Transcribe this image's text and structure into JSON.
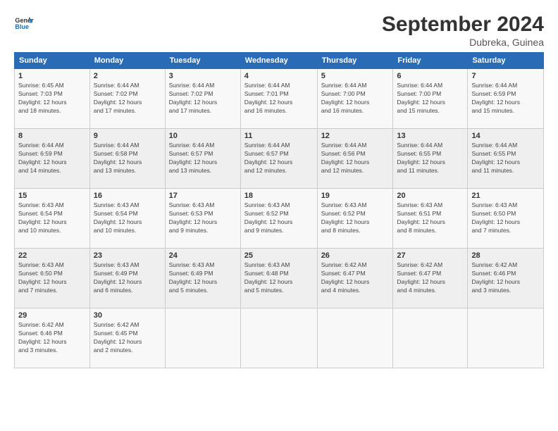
{
  "header": {
    "title": "September 2024",
    "subtitle": "Dubreka, Guinea"
  },
  "columns": [
    "Sunday",
    "Monday",
    "Tuesday",
    "Wednesday",
    "Thursday",
    "Friday",
    "Saturday"
  ],
  "weeks": [
    [
      {
        "day": "1",
        "detail": "Sunrise: 6:45 AM\nSunset: 7:03 PM\nDaylight: 12 hours\nand 18 minutes."
      },
      {
        "day": "2",
        "detail": "Sunrise: 6:44 AM\nSunset: 7:02 PM\nDaylight: 12 hours\nand 17 minutes."
      },
      {
        "day": "3",
        "detail": "Sunrise: 6:44 AM\nSunset: 7:02 PM\nDaylight: 12 hours\nand 17 minutes."
      },
      {
        "day": "4",
        "detail": "Sunrise: 6:44 AM\nSunset: 7:01 PM\nDaylight: 12 hours\nand 16 minutes."
      },
      {
        "day": "5",
        "detail": "Sunrise: 6:44 AM\nSunset: 7:00 PM\nDaylight: 12 hours\nand 16 minutes."
      },
      {
        "day": "6",
        "detail": "Sunrise: 6:44 AM\nSunset: 7:00 PM\nDaylight: 12 hours\nand 15 minutes."
      },
      {
        "day": "7",
        "detail": "Sunrise: 6:44 AM\nSunset: 6:59 PM\nDaylight: 12 hours\nand 15 minutes."
      }
    ],
    [
      {
        "day": "8",
        "detail": "Sunrise: 6:44 AM\nSunset: 6:59 PM\nDaylight: 12 hours\nand 14 minutes."
      },
      {
        "day": "9",
        "detail": "Sunrise: 6:44 AM\nSunset: 6:58 PM\nDaylight: 12 hours\nand 13 minutes."
      },
      {
        "day": "10",
        "detail": "Sunrise: 6:44 AM\nSunset: 6:57 PM\nDaylight: 12 hours\nand 13 minutes."
      },
      {
        "day": "11",
        "detail": "Sunrise: 6:44 AM\nSunset: 6:57 PM\nDaylight: 12 hours\nand 12 minutes."
      },
      {
        "day": "12",
        "detail": "Sunrise: 6:44 AM\nSunset: 6:56 PM\nDaylight: 12 hours\nand 12 minutes."
      },
      {
        "day": "13",
        "detail": "Sunrise: 6:44 AM\nSunset: 6:55 PM\nDaylight: 12 hours\nand 11 minutes."
      },
      {
        "day": "14",
        "detail": "Sunrise: 6:44 AM\nSunset: 6:55 PM\nDaylight: 12 hours\nand 11 minutes."
      }
    ],
    [
      {
        "day": "15",
        "detail": "Sunrise: 6:43 AM\nSunset: 6:54 PM\nDaylight: 12 hours\nand 10 minutes."
      },
      {
        "day": "16",
        "detail": "Sunrise: 6:43 AM\nSunset: 6:54 PM\nDaylight: 12 hours\nand 10 minutes."
      },
      {
        "day": "17",
        "detail": "Sunrise: 6:43 AM\nSunset: 6:53 PM\nDaylight: 12 hours\nand 9 minutes."
      },
      {
        "day": "18",
        "detail": "Sunrise: 6:43 AM\nSunset: 6:52 PM\nDaylight: 12 hours\nand 9 minutes."
      },
      {
        "day": "19",
        "detail": "Sunrise: 6:43 AM\nSunset: 6:52 PM\nDaylight: 12 hours\nand 8 minutes."
      },
      {
        "day": "20",
        "detail": "Sunrise: 6:43 AM\nSunset: 6:51 PM\nDaylight: 12 hours\nand 8 minutes."
      },
      {
        "day": "21",
        "detail": "Sunrise: 6:43 AM\nSunset: 6:50 PM\nDaylight: 12 hours\nand 7 minutes."
      }
    ],
    [
      {
        "day": "22",
        "detail": "Sunrise: 6:43 AM\nSunset: 6:50 PM\nDaylight: 12 hours\nand 7 minutes."
      },
      {
        "day": "23",
        "detail": "Sunrise: 6:43 AM\nSunset: 6:49 PM\nDaylight: 12 hours\nand 6 minutes."
      },
      {
        "day": "24",
        "detail": "Sunrise: 6:43 AM\nSunset: 6:49 PM\nDaylight: 12 hours\nand 5 minutes."
      },
      {
        "day": "25",
        "detail": "Sunrise: 6:43 AM\nSunset: 6:48 PM\nDaylight: 12 hours\nand 5 minutes."
      },
      {
        "day": "26",
        "detail": "Sunrise: 6:42 AM\nSunset: 6:47 PM\nDaylight: 12 hours\nand 4 minutes."
      },
      {
        "day": "27",
        "detail": "Sunrise: 6:42 AM\nSunset: 6:47 PM\nDaylight: 12 hours\nand 4 minutes."
      },
      {
        "day": "28",
        "detail": "Sunrise: 6:42 AM\nSunset: 6:46 PM\nDaylight: 12 hours\nand 3 minutes."
      }
    ],
    [
      {
        "day": "29",
        "detail": "Sunrise: 6:42 AM\nSunset: 6:46 PM\nDaylight: 12 hours\nand 3 minutes."
      },
      {
        "day": "30",
        "detail": "Sunrise: 6:42 AM\nSunset: 6:45 PM\nDaylight: 12 hours\nand 2 minutes."
      },
      {
        "day": "",
        "detail": ""
      },
      {
        "day": "",
        "detail": ""
      },
      {
        "day": "",
        "detail": ""
      },
      {
        "day": "",
        "detail": ""
      },
      {
        "day": "",
        "detail": ""
      }
    ]
  ]
}
